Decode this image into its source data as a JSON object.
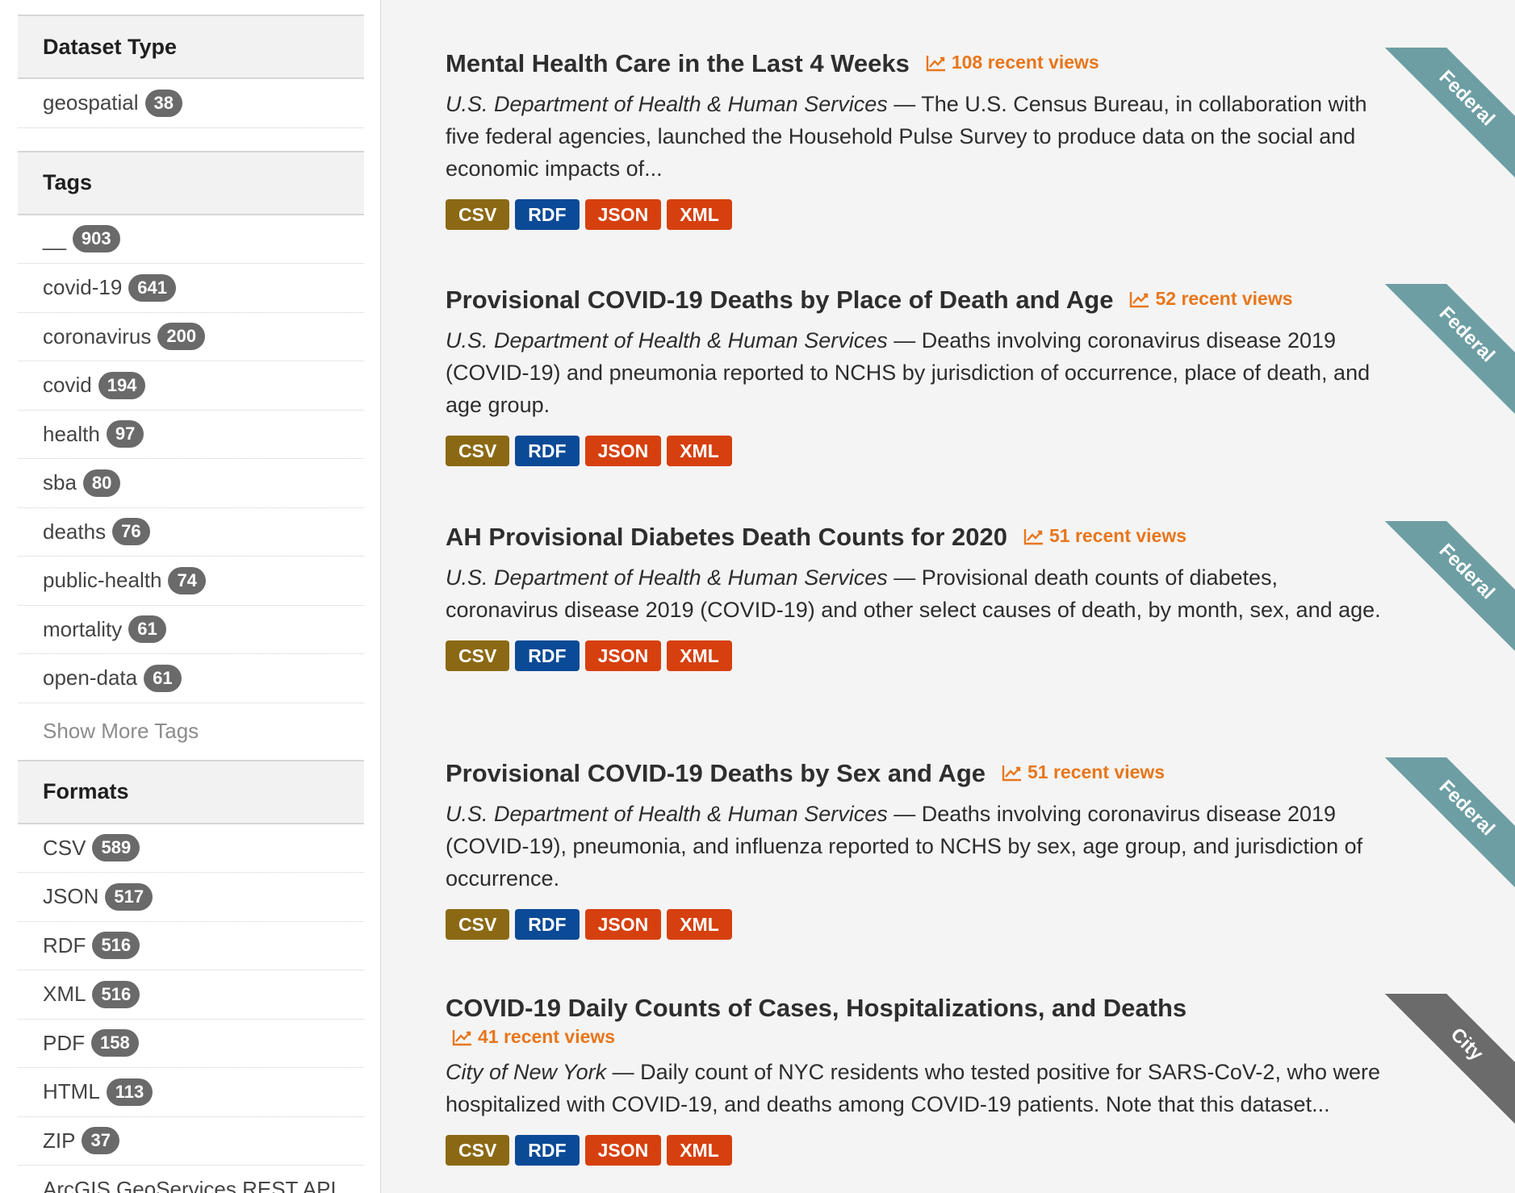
{
  "sidebar": {
    "dataset_type": {
      "heading": "Dataset Type",
      "items": [
        {
          "label": "geospatial",
          "count": "38"
        }
      ]
    },
    "tags": {
      "heading": "Tags",
      "items": [
        {
          "label": "__",
          "count": "903"
        },
        {
          "label": "covid-19",
          "count": "641"
        },
        {
          "label": "coronavirus",
          "count": "200"
        },
        {
          "label": "covid",
          "count": "194"
        },
        {
          "label": "health",
          "count": "97"
        },
        {
          "label": "sba",
          "count": "80"
        },
        {
          "label": "deaths",
          "count": "76"
        },
        {
          "label": "public-health",
          "count": "74"
        },
        {
          "label": "mortality",
          "count": "61"
        },
        {
          "label": "open-data",
          "count": "61"
        }
      ],
      "show_more": "Show More Tags"
    },
    "formats": {
      "heading": "Formats",
      "items": [
        {
          "label": "CSV",
          "count": "589"
        },
        {
          "label": "JSON",
          "count": "517"
        },
        {
          "label": "RDF",
          "count": "516"
        },
        {
          "label": "XML",
          "count": "516"
        },
        {
          "label": "PDF",
          "count": "158"
        },
        {
          "label": "HTML",
          "count": "113"
        },
        {
          "label": "ZIP",
          "count": "37"
        },
        {
          "label": "ArcGIS GeoServices REST API",
          "count": ""
        }
      ]
    }
  },
  "colors": {
    "csv": "#8b6914",
    "rdf": "#0b4a96",
    "json": "#d6400f",
    "xml": "#d6400f",
    "views": "#e8761b",
    "ribbon_federal": "#6d9ea3",
    "ribbon_city": "#6b6b6b"
  },
  "datasets": [
    {
      "title": "Mental Health Care in the Last 4 Weeks",
      "views": "108 recent views",
      "organization": "U.S. Department of Health & Human Services",
      "separator": " — ",
      "description": "The U.S. Census Bureau, in collaboration with five federal agencies, launched the Household Pulse Survey to produce data on the social and economic impacts of...",
      "formats": [
        "CSV",
        "RDF",
        "JSON",
        "XML"
      ],
      "ribbon": "Federal"
    },
    {
      "title": "Provisional COVID-19 Deaths by Place of Death and Age",
      "views": "52 recent views",
      "organization": "U.S. Department of Health & Human Services",
      "separator": " — ",
      "description": "Deaths involving coronavirus disease 2019 (COVID-19) and pneumonia reported to NCHS by jurisdiction of occurrence, place of death, and age group.",
      "formats": [
        "CSV",
        "RDF",
        "JSON",
        "XML"
      ],
      "ribbon": "Federal"
    },
    {
      "title": "AH Provisional Diabetes Death Counts for 2020",
      "views": "51 recent views",
      "organization": "U.S. Department of Health & Human Services",
      "separator": " — ",
      "description": "Provisional death counts of diabetes, coronavirus disease 2019 (COVID-19) and other select causes of death, by month, sex, and age.",
      "formats": [
        "CSV",
        "RDF",
        "JSON",
        "XML"
      ],
      "ribbon": "Federal"
    },
    {
      "title": "Provisional COVID-19 Deaths by Sex and Age",
      "views": "51 recent views",
      "organization": "U.S. Department of Health & Human Services",
      "separator": " — ",
      "description": "Deaths involving coronavirus disease 2019 (COVID-19), pneumonia, and influenza reported to NCHS by sex, age group, and jurisdiction of occurrence.",
      "formats": [
        "CSV",
        "RDF",
        "JSON",
        "XML"
      ],
      "ribbon": "Federal"
    },
    {
      "title": "COVID-19 Daily Counts of Cases, Hospitalizations, and Deaths",
      "views": "41 recent views",
      "organization": "City of New York",
      "separator": " — ",
      "description": "Daily count of NYC residents who tested positive for SARS-CoV-2, who were hospitalized with COVID-19, and deaths among COVID-19 patients. Note that this dataset...",
      "formats": [
        "CSV",
        "RDF",
        "JSON",
        "XML"
      ],
      "ribbon": "City"
    }
  ]
}
